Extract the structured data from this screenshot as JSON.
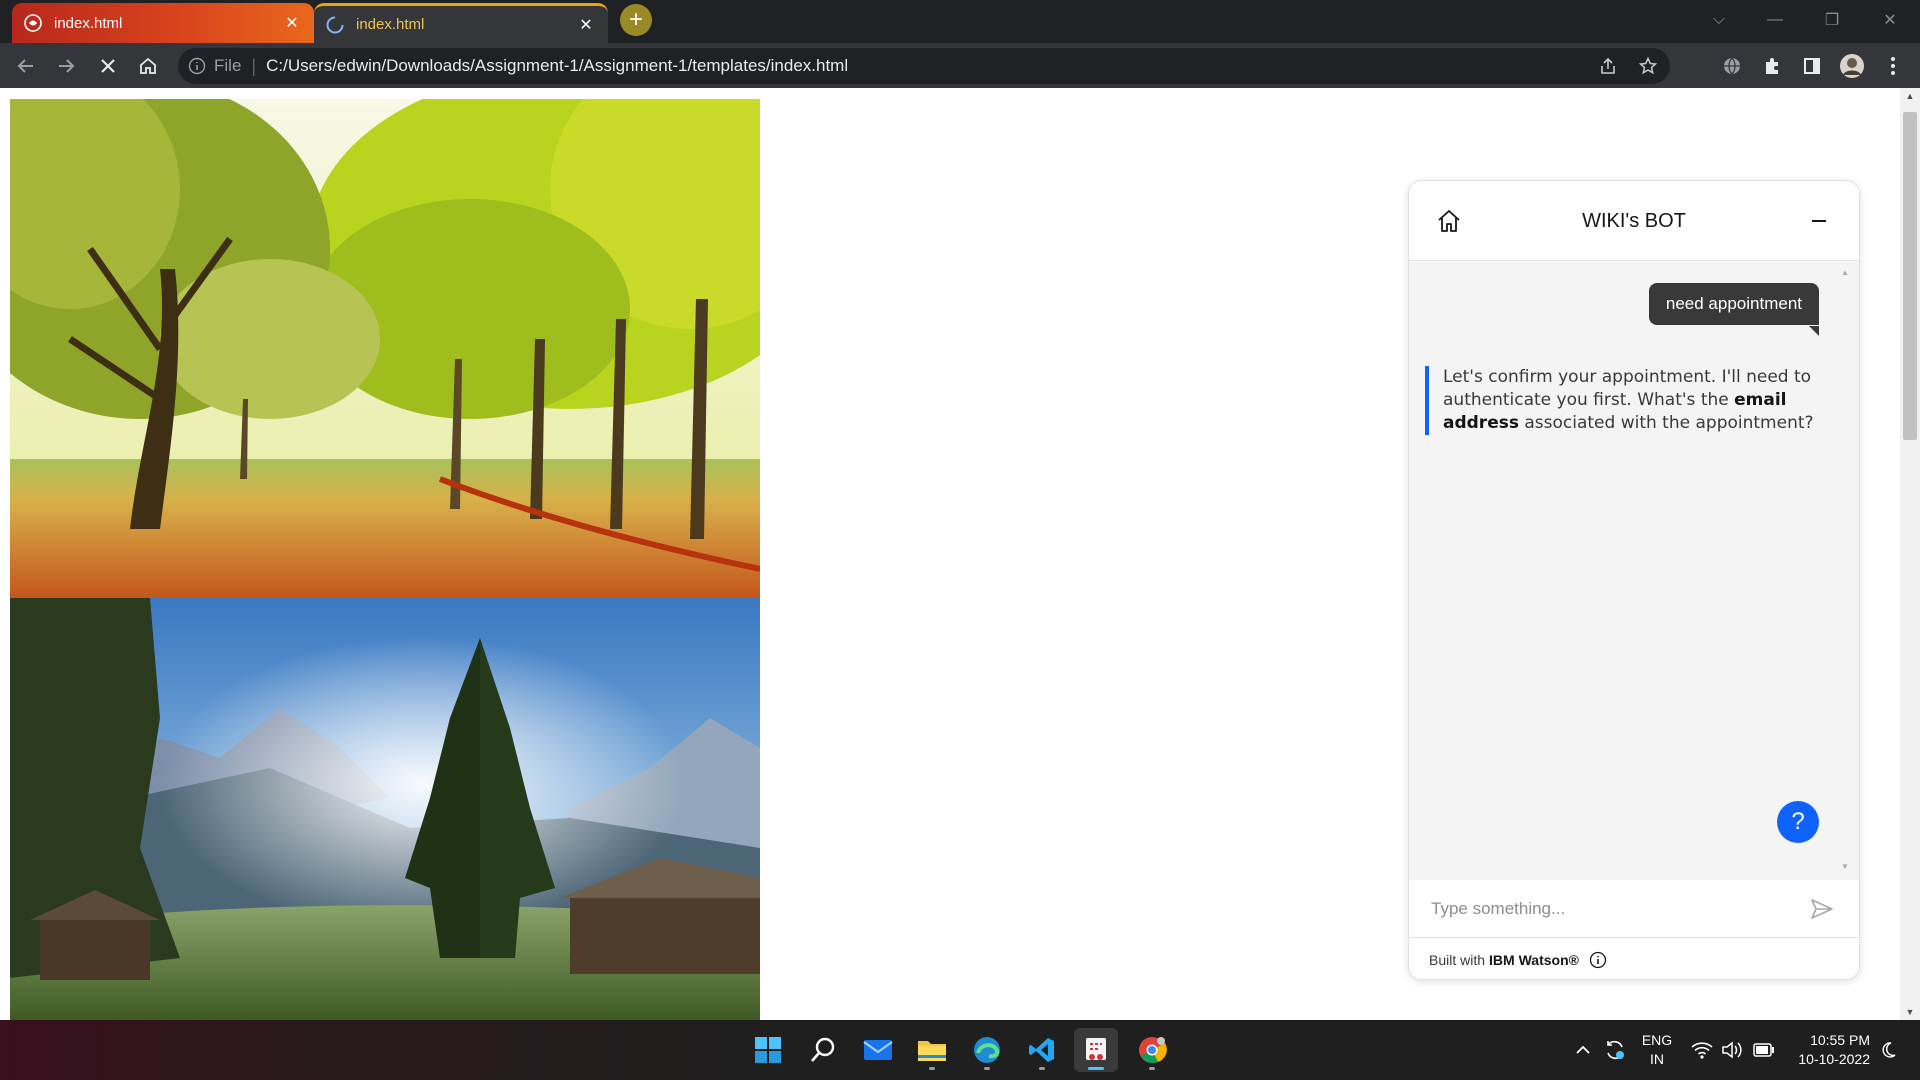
{
  "browser": {
    "tabs": [
      {
        "title": "index.html",
        "active": false
      },
      {
        "title": "index.html",
        "active": true
      }
    ],
    "address": {
      "scheme": "File",
      "url": "C:/Users/edwin/Downloads/Assignment-1/Assignment-1/templates/index.html"
    }
  },
  "chat": {
    "title": "WIKI's BOT",
    "messages": [
      {
        "from": "user",
        "text": "need appointment"
      },
      {
        "from": "bot",
        "text_parts": [
          "Let's confirm your appointment. I'll need to authenticate you first. What's the ",
          "email address",
          " associated with the appointment?"
        ]
      }
    ],
    "help_label": "?",
    "input_placeholder": "Type something...",
    "footer_prefix": "Built with",
    "footer_brand": "IBM Watson®",
    "accent_color": "#0f62fe"
  },
  "images": [
    {
      "name": "autumn-park-photo"
    },
    {
      "name": "mountain-meadow-photo"
    }
  ],
  "taskbar": {
    "apps": [
      "windows-start",
      "search",
      "mail",
      "file-explorer",
      "edge",
      "vscode",
      "snipping-tool",
      "chrome"
    ],
    "lang_line1": "ENG",
    "lang_line2": "IN",
    "time": "10:55 PM",
    "date": "10-10-2022"
  }
}
